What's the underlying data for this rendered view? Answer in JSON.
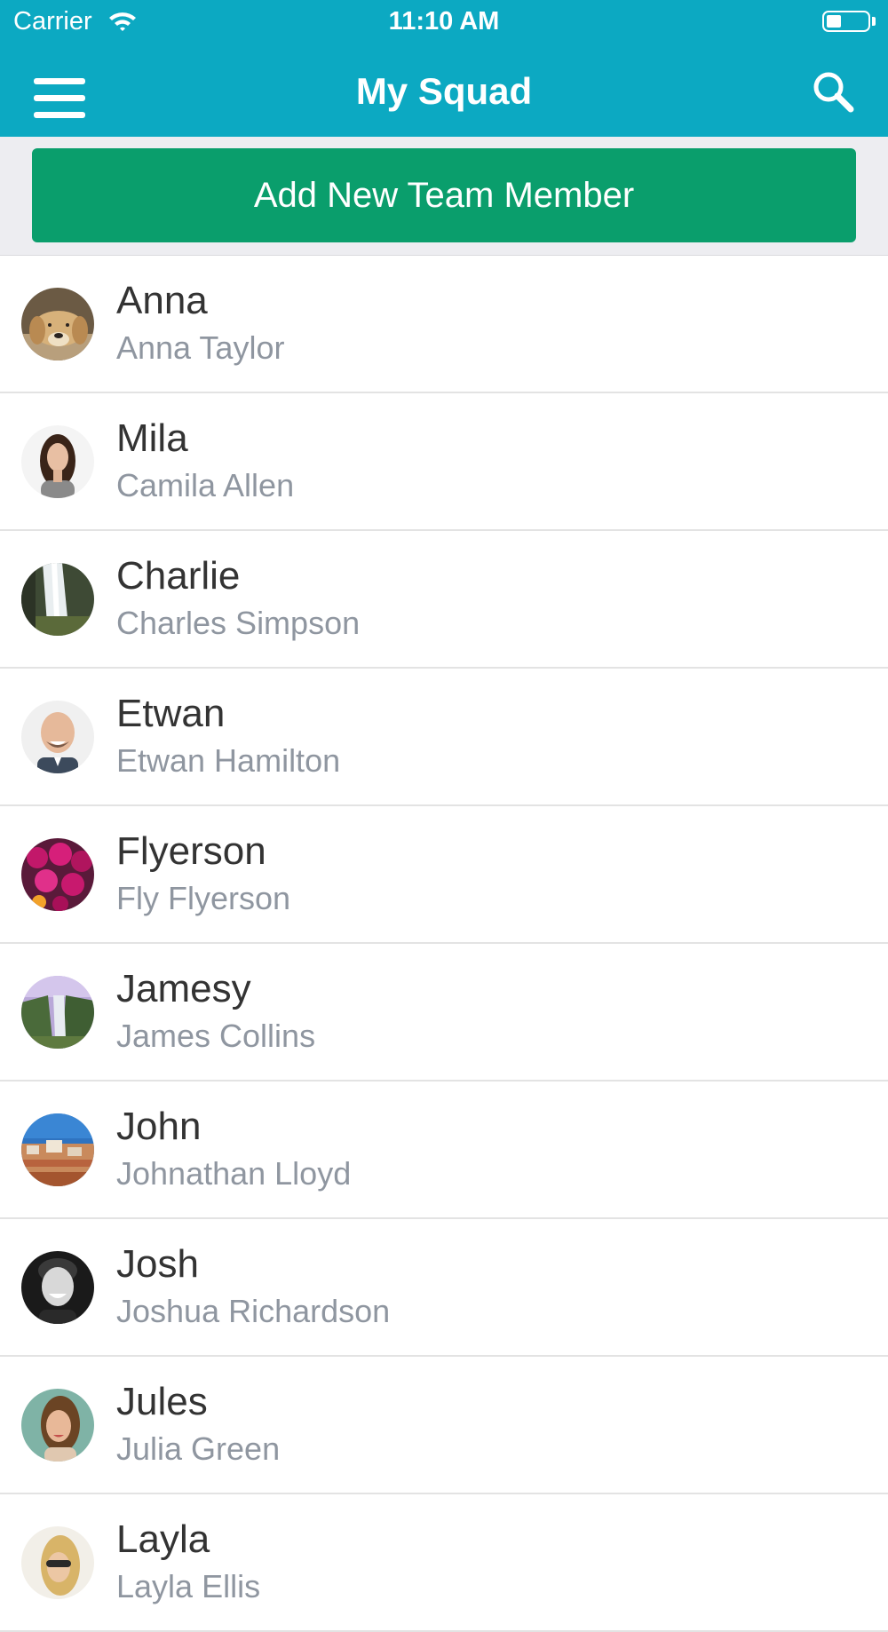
{
  "status_bar": {
    "carrier": "Carrier",
    "time": "11:10 AM",
    "battery_level": 0.35
  },
  "nav": {
    "title": "My Squad",
    "menu_icon": "hamburger-menu-icon",
    "search_icon": "search-icon"
  },
  "actions": {
    "add_label": "Add New Team Member"
  },
  "colors": {
    "header": "#0ca9c2",
    "button": "#0a9e6c",
    "primary_text": "#333333",
    "secondary_text": "#8f96a0"
  },
  "members": [
    {
      "nickname": "Anna",
      "full_name": "Anna Taylor",
      "avatar": "golden-retriever-photo"
    },
    {
      "nickname": "Mila",
      "full_name": "Camila Allen",
      "avatar": "woman-portrait-photo"
    },
    {
      "nickname": "Charlie",
      "full_name": "Charles Simpson",
      "avatar": "waterfall-photo"
    },
    {
      "nickname": "Etwan",
      "full_name": "Etwan Hamilton",
      "avatar": "smiling-man-photo"
    },
    {
      "nickname": "Flyerson",
      "full_name": "Fly  Flyerson",
      "avatar": "pink-flowers-photo"
    },
    {
      "nickname": "Jamesy",
      "full_name": "James Collins",
      "avatar": "waterfall-landscape-photo"
    },
    {
      "nickname": "John",
      "full_name": "Johnathan Lloyd",
      "avatar": "city-rooftops-photo"
    },
    {
      "nickname": "Josh",
      "full_name": "Joshua Richardson",
      "avatar": "bw-man-portrait-photo"
    },
    {
      "nickname": "Jules",
      "full_name": "Julia Green",
      "avatar": "woman-teal-background-photo"
    },
    {
      "nickname": "Layla",
      "full_name": "Layla Ellis",
      "avatar": "woman-sunglasses-photo"
    }
  ]
}
